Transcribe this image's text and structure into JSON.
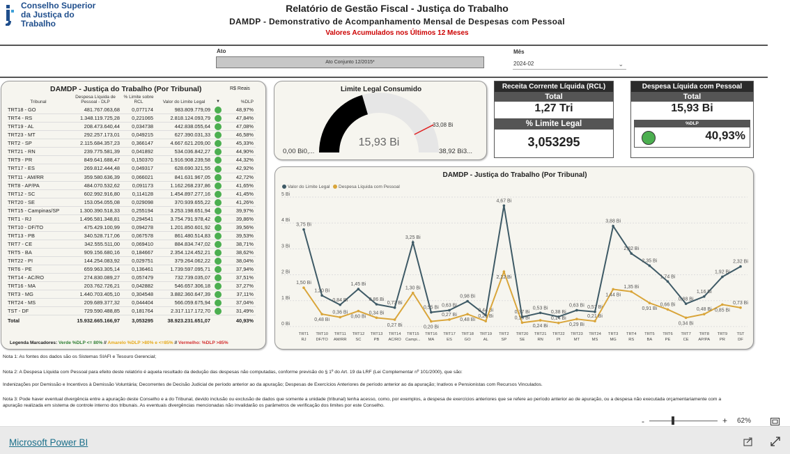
{
  "header": {
    "logo_line1": "Conselho Superior",
    "logo_line2": "da Justiça do Trabalho",
    "title": "Relatório de Gestão Fiscal - Justiça do Trabalho",
    "subtitle": "DAMDP - Demonstrativo de Acompanhamento Mensal de Despesas com Pessoal",
    "subtitle2": "Valores Acumulados nos Últimos 12 Meses"
  },
  "filters": {
    "ato_label": "Ato",
    "ato_value": "Ato Conjunto 12/2015*",
    "mes_label": "Mês",
    "mes_value": "2024-02"
  },
  "table": {
    "title": "DAMDP - Justiça do Trabalho (Por Tribunal)",
    "currency": "R$ Reais",
    "columns": [
      "Tribunal",
      "Despesa Líquida de Pessoal - DLP",
      "% Limite sobre RCL",
      "Valor do Limite Legal",
      "",
      "%DLP"
    ],
    "rows": [
      [
        "TRT18 - GO",
        "481.767.063,68",
        "0,077174",
        "983.809.779,09",
        "48,97%"
      ],
      [
        "TRT4 - RS",
        "1.348.119.725,28",
        "0,221065",
        "2.818.124.093,79",
        "47,84%"
      ],
      [
        "TRT19 - AL",
        "208.473.640,44",
        "0,034738",
        "442.838.055,64",
        "47,08%"
      ],
      [
        "TRT23 - MT",
        "292.257.173,01",
        "0,049215",
        "627.390.031,33",
        "46,58%"
      ],
      [
        "TRT2 - SP",
        "2.115.684.357,23",
        "0,366147",
        "4.667.621.209,00",
        "45,33%"
      ],
      [
        "TRT21 - RN",
        "239.775.581,39",
        "0,041892",
        "534.036.842,27",
        "44,90%"
      ],
      [
        "TRT9 - PR",
        "849.641.688,47",
        "0,150370",
        "1.916.908.239,58",
        "44,32%"
      ],
      [
        "TRT17 - ES",
        "269.812.444,48",
        "0,049317",
        "628.690.321,55",
        "42,92%"
      ],
      [
        "TRT11 - AM/RR",
        "359.580.636,39",
        "0,066021",
        "841.631.967,05",
        "42,72%"
      ],
      [
        "TRT8 - AP/PA",
        "484.070.532,62",
        "0,091173",
        "1.162.268.237,86",
        "41,65%"
      ],
      [
        "TRT12 - SC",
        "602.992.916,80",
        "0,114128",
        "1.454.897.277,16",
        "41,45%"
      ],
      [
        "TRT20 - SE",
        "153.054.055,08",
        "0,029098",
        "370.939.655,22",
        "41,26%"
      ],
      [
        "TRT15 - Campinas/SP",
        "1.300.390.518,33",
        "0,255194",
        "3.253.198.651,94",
        "39,97%"
      ],
      [
        "TRT1 - RJ",
        "1.496.581.348,81",
        "0,294541",
        "3.754.791.978,42",
        "39,86%"
      ],
      [
        "TRT10 - DF/TO",
        "475.429.100,99",
        "0,094278",
        "1.201.850.601,92",
        "39,56%"
      ],
      [
        "TRT13 - PB",
        "340.528.717,06",
        "0,067578",
        "861.480.514,83",
        "39,53%"
      ],
      [
        "TRT7 - CE",
        "342.555.511,00",
        "0,069410",
        "884.834.747,02",
        "38,71%"
      ],
      [
        "TRT5 - BA",
        "909.156.680,16",
        "0,184667",
        "2.354.124.452,21",
        "38,62%"
      ],
      [
        "TRT22 - PI",
        "144.254.083,92",
        "0,029751",
        "379.264.062,22",
        "38,04%"
      ],
      [
        "TRT6 - PE",
        "659.963.305,14",
        "0,136461",
        "1.739.597.095,71",
        "37,94%"
      ],
      [
        "TRT14 - AC/RO",
        "274.830.089,27",
        "0,057479",
        "732.739.035,07",
        "37,51%"
      ],
      [
        "TRT16 - MA",
        "203.762.726,21",
        "0,042882",
        "546.657.306,18",
        "37,27%"
      ],
      [
        "TRT3 - MG",
        "1.440.703.405,10",
        "0,304548",
        "3.882.360.647,39",
        "37,11%"
      ],
      [
        "TRT24 - MS",
        "209.689.377,32",
        "0,044404",
        "566.059.675,94",
        "37,04%"
      ],
      [
        "TST - DF",
        "729.590.488,85",
        "0,181764",
        "2.317.117.172,70",
        "31,49%"
      ]
    ],
    "total": [
      "Total",
      "15.932.665.166,97",
      "3,053295",
      "38.923.231.651,07",
      "40,93%"
    ],
    "legend_prefix": "Legenda Marcadores:",
    "legend_green": "Verde %DLP <= 80%",
    "legend_sep1": "//",
    "legend_amber": "Amarelo %DLP >80% e <=85%",
    "legend_sep2": "//",
    "legend_red": "Vermelho: %DLP >85%",
    "colors": {
      "green": "#4caf50",
      "amber": "#e6a817",
      "red": "#d32f2f"
    }
  },
  "gauge": {
    "title": "Limite Legal Consumido",
    "value_label": "15,93 Bi",
    "min_label": "0,00 Bi0,...",
    "max_label": "38,92 Bi3...",
    "target_label": "33,08 Bi",
    "value": 15.93,
    "max": 38.92,
    "target": 33.08
  },
  "kpi_rcl": {
    "header": "Receita Corrente Líquida (RCL)",
    "total_label": "Total",
    "total_value": "1,27 Tri",
    "limit_label": "% Limite Legal",
    "limit_value": "3,053295"
  },
  "kpi_dlp": {
    "header": "Despesa Líquida com Pessoal",
    "total_label": "Total",
    "total_value": "15,93 Bi",
    "pct_label": "%DLP",
    "pct_value": "40,93%"
  },
  "chart_data": {
    "type": "line",
    "title": "DAMDP - Justiça do Trabalho (Por Tribunal)",
    "ylim": [
      0,
      5
    ],
    "y_ticks": [
      "0 Bi",
      "1 Bi",
      "2 Bi",
      "3 Bi",
      "4 Bi",
      "5 Bi"
    ],
    "categories": [
      "TRT1 - RJ",
      "TRT10 - DF/TO",
      "TRT11 - AM/RR",
      "TRT12 - SC",
      "TRT13 - PB",
      "TRT14 - AC/RO",
      "TRT15 - Campi...",
      "TRT16 - MA",
      "TRT17 - ES",
      "TRT18 - GO",
      "TRT19 - AL",
      "TRT2 - SP",
      "TRT20 - SE",
      "TRT21 - RN",
      "TRT22 - PI",
      "TRT23 - MT",
      "TRT24 - MS",
      "TRT3 - MG",
      "TRT4 - RS",
      "TRT5 - BA",
      "TRT6 - PE",
      "TRT7 - CE",
      "TRT8 - AP/PA",
      "TRT9 - PR",
      "TST - DF"
    ],
    "series": [
      {
        "name": "Valor do Limite Legal",
        "color": "#3e5a66",
        "values": [
          3.75,
          1.2,
          0.84,
          1.45,
          0.86,
          0.73,
          3.25,
          0.55,
          0.63,
          0.98,
          0.44,
          4.67,
          0.37,
          0.53,
          0.38,
          0.63,
          0.57,
          3.88,
          2.82,
          2.35,
          1.74,
          0.88,
          1.16,
          1.92,
          2.32
        ],
        "labels": [
          "3,75 Bi",
          "1,20 Bi",
          "0,84 Bi",
          "1,45 Bi",
          "0,86 Bi",
          "0,73 Bi",
          "3,25 Bi",
          "0,55 Bi",
          "0,63 Bi",
          "0,98 Bi",
          "0,44 Bi",
          "4,67 Bi",
          "0,37 Bi",
          "0,53 Bi",
          "0,38 Bi",
          "0,63 Bi",
          "0,57 Bi",
          "3,88 Bi",
          "2,82 Bi",
          "2,35 Bi",
          "1,74 Bi",
          "0,88 Bi",
          "1,16 Bi",
          "1,92 Bi",
          "2,32 Bi"
        ]
      },
      {
        "name": "Despesa Líquida com Pessoal",
        "color": "#d9a53a",
        "values": [
          1.5,
          0.48,
          0.36,
          0.6,
          0.34,
          0.27,
          1.3,
          0.2,
          0.27,
          0.48,
          0.21,
          2.12,
          0.15,
          0.24,
          0.14,
          0.29,
          0.21,
          1.44,
          1.35,
          0.91,
          0.66,
          0.34,
          0.48,
          0.85,
          0.73
        ],
        "labels": [
          "1,50 Bi",
          "0,48 Bi",
          "0,36 Bi",
          "0,60 Bi",
          "0,34 Bi",
          "0,27 Bi",
          "1,30 Bi",
          "0,20 Bi",
          "0,27 Bi",
          "0,48 Bi",
          "0,21 Bi",
          "2,12 Bi",
          "0,15 Bi",
          "0,24 Bi",
          "0,14 Bi",
          "0,29 Bi",
          "0,21 Bi",
          "1,44 Bi",
          "1,35 Bi",
          "0,91 Bi",
          "0,66 Bi",
          "0,34 Bi",
          "0,48 Bi",
          "0,85 Bi",
          "0,73 Bi"
        ]
      }
    ]
  },
  "notes": {
    "n1": "Nota 1: As fontes dos dados são os Sistemas SIAFI e Tesouro Gerencial;",
    "n2": "Nota 2: A Despesa Líquida com Pessoal para efeito deste relatório é aquela resultado da dedução das despesas não computadas, conforme previsão do § 1º do Art. 19 da LRF (Lei Complementar nº 101/2000), que são:",
    "n2b": "Indenizações por Demissão e Incentivos à Demissão Voluntária; Decorrentes de Decisão Judicial de período anterior ao da apuração; Despesas de Exercícios Anteriores de período anterior ao da apuração; Inativos e Pensionistas com Recursos Vinculados.",
    "n3": "Nota 3: Pode haver eventual divergência entre a apuração deste Conselho e a do Tribunal, devido inclusão ou exclusão de dados que somente a unidade (tribunal) tenha acesso, como, por exemplos, a despesa de exercícios anteriores que se refere ao período anterior ao de apuração, ou a despesa não executada orçamentariamente com a apuração realizada em sistema de controle interno dos tribunais. As eventuais divergências mencionadas não invalidarão os parâmetros de verificação dos limites por este Conselho."
  },
  "zoom": {
    "minus": "-",
    "plus": "+",
    "level": "62%",
    "fraction": 0.35
  },
  "footer": {
    "brand": "Microsoft Power BI"
  }
}
